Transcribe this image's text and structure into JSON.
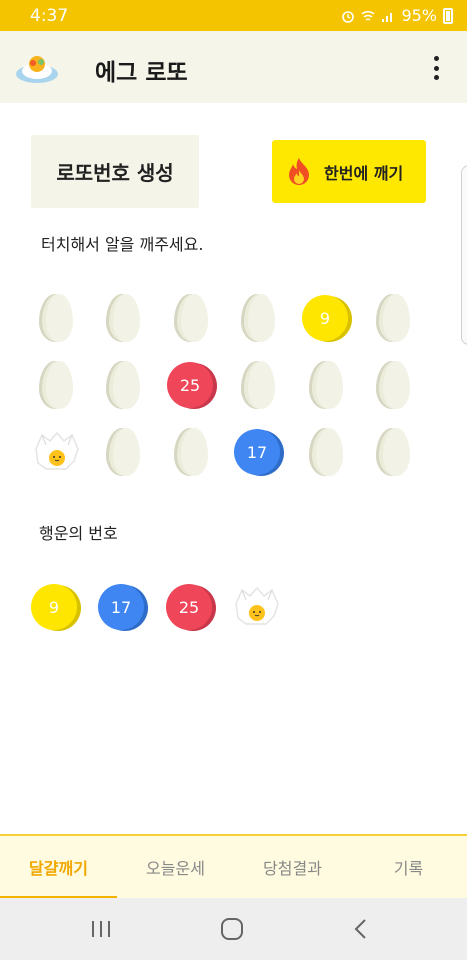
{
  "status_bar": {
    "time": "4:37",
    "battery": "95%"
  },
  "app_bar": {
    "title": "에그 로또",
    "logo_icon": "fried-egg-logo-icon",
    "menu_icon": "more-vertical-icon"
  },
  "actions": {
    "generate_label": "로또번호 생성",
    "break_all_label": "한번에 깨기",
    "break_all_icon": "fire-icon"
  },
  "instruction": "터치해서 알을 깨주세요.",
  "egg_grid": {
    "rows": [
      [
        {
          "state": "egg"
        },
        {
          "state": "egg"
        },
        {
          "state": "egg"
        },
        {
          "state": "egg"
        },
        {
          "state": "ball",
          "number": "9",
          "color": "yellow"
        },
        {
          "state": "egg"
        }
      ],
      [
        {
          "state": "egg"
        },
        {
          "state": "egg"
        },
        {
          "state": "ball",
          "number": "25",
          "color": "red"
        },
        {
          "state": "egg"
        },
        {
          "state": "egg"
        },
        {
          "state": "egg"
        }
      ],
      [
        {
          "state": "fried"
        },
        {
          "state": "egg"
        },
        {
          "state": "egg"
        },
        {
          "state": "ball",
          "number": "17",
          "color": "blue"
        },
        {
          "state": "egg"
        },
        {
          "state": "egg"
        }
      ]
    ]
  },
  "lucky": {
    "title": "행운의 번호",
    "items": [
      {
        "state": "ball",
        "number": "9",
        "color": "yellow"
      },
      {
        "state": "ball",
        "number": "17",
        "color": "blue"
      },
      {
        "state": "ball",
        "number": "25",
        "color": "red"
      },
      {
        "state": "fried"
      }
    ]
  },
  "bottom_nav": {
    "tabs": [
      {
        "label": "달걀깨기",
        "active": true
      },
      {
        "label": "오늘운세",
        "active": false
      },
      {
        "label": "당첨결과",
        "active": false
      },
      {
        "label": "기록",
        "active": false
      }
    ]
  },
  "colors": {
    "status_bar": "#f5c400",
    "accent": "#ffe800",
    "ball_yellow": "#ffe600",
    "ball_red": "#f0465a",
    "ball_blue": "#3f86f2"
  }
}
